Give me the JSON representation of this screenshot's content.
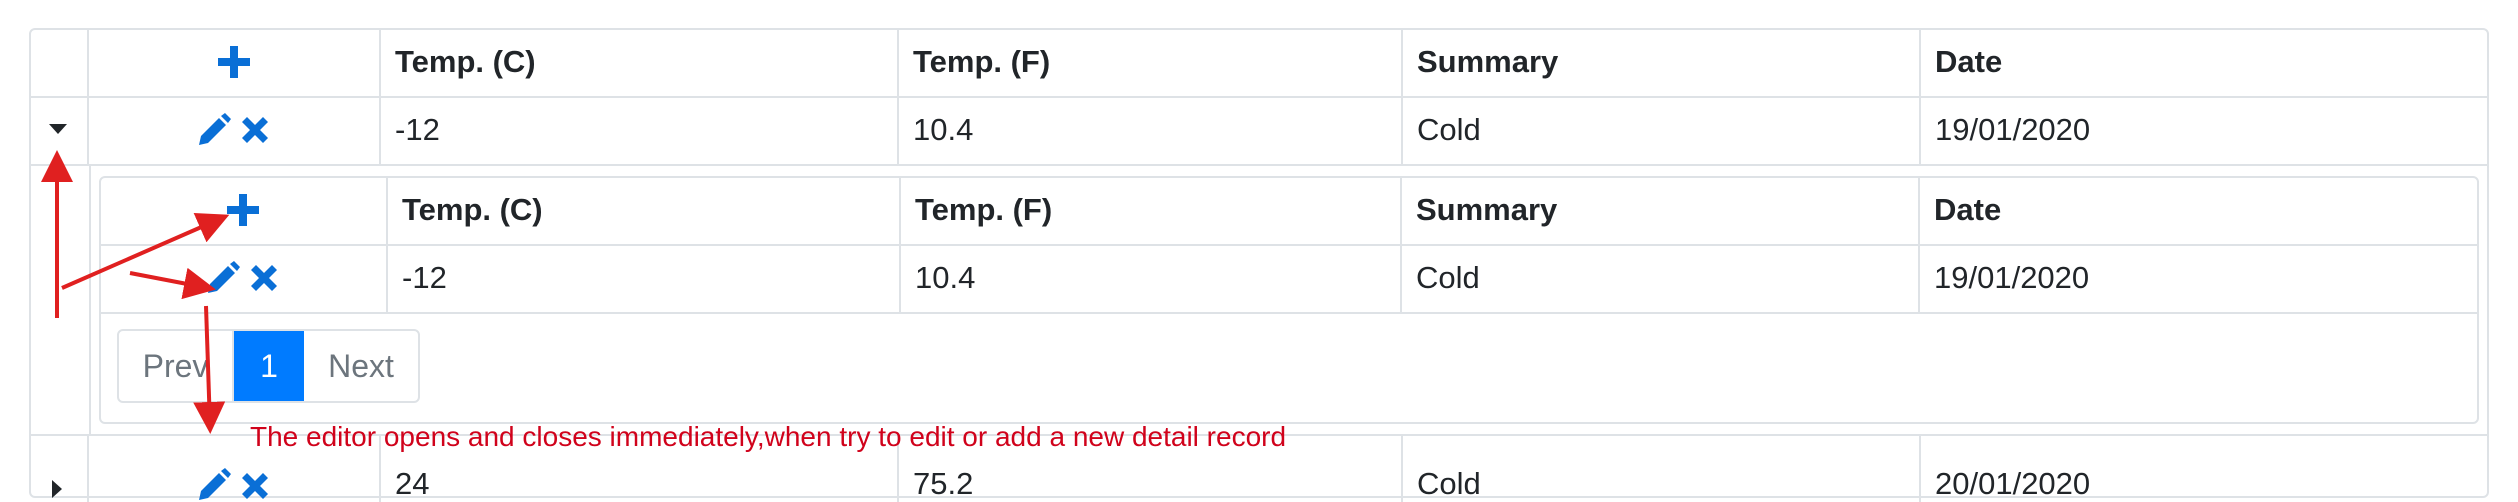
{
  "master": {
    "columns": [
      "Temp. (C)",
      "Temp. (F)",
      "Summary",
      "Date"
    ],
    "rows": [
      {
        "temp_c": "-12",
        "temp_f": "10.4",
        "summary": "Cold",
        "date": "19/01/2020"
      },
      {
        "temp_c": "24",
        "temp_f": "75.2",
        "summary": "Cold",
        "date": "20/01/2020"
      }
    ]
  },
  "detail": {
    "columns": [
      "Temp. (C)",
      "Temp. (F)",
      "Summary",
      "Date"
    ],
    "rows": [
      {
        "temp_c": "-12",
        "temp_f": "10.4",
        "summary": "Cold",
        "date": "19/01/2020"
      }
    ],
    "pager": {
      "prev": "Prev",
      "current_page": "1",
      "next": "Next"
    }
  },
  "annotation": {
    "text": "The editor opens and closes immediately,when try to edit or add a new detail record"
  },
  "icons": {
    "add": "plus-icon",
    "edit": "pencil-icon",
    "delete": "close-icon",
    "expanded": "caret-down-icon",
    "collapsed": "caret-right-icon"
  },
  "colors": {
    "icon_blue": "#0a6fd6",
    "active_page": "#007bff",
    "annotation_red": "#d0021b",
    "border": "#dee2e6"
  }
}
